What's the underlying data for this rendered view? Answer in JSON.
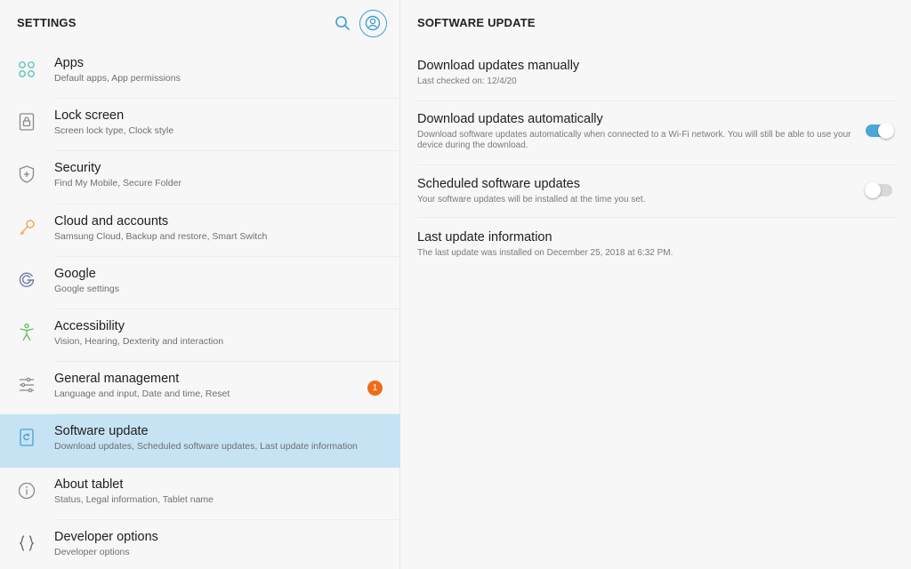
{
  "left": {
    "title": "SETTINGS",
    "menu": [
      {
        "title": "Apps",
        "subtitle": "Default apps, App permissions",
        "icon": "apps-icon"
      },
      {
        "title": "Lock screen",
        "subtitle": "Screen lock type, Clock style",
        "icon": "lock-icon"
      },
      {
        "title": "Security",
        "subtitle": "Find My Mobile, Secure Folder",
        "icon": "shield-icon"
      },
      {
        "title": "Cloud and accounts",
        "subtitle": "Samsung Cloud, Backup and restore, Smart Switch",
        "icon": "key-icon"
      },
      {
        "title": "Google",
        "subtitle": "Google settings",
        "icon": "google-icon"
      },
      {
        "title": "Accessibility",
        "subtitle": "Vision, Hearing, Dexterity and interaction",
        "icon": "accessibility-icon"
      },
      {
        "title": "General management",
        "subtitle": "Language and input, Date and time, Reset",
        "icon": "sliders-icon",
        "badge": "1"
      },
      {
        "title": "Software update",
        "subtitle": "Download updates, Scheduled software updates, Last update information",
        "icon": "software-update-icon",
        "selected": true
      },
      {
        "title": "About tablet",
        "subtitle": "Status, Legal information, Tablet name",
        "icon": "info-icon"
      },
      {
        "title": "Developer options",
        "subtitle": "Developer options",
        "icon": "braces-icon"
      }
    ]
  },
  "right": {
    "title": "SOFTWARE UPDATE",
    "items": [
      {
        "title": "Download updates manually",
        "subtitle": "Last checked on: 12/4/20"
      },
      {
        "title": "Download updates automatically",
        "subtitle": "Download software updates automatically when connected to a Wi-Fi network. You will still be able to use your device during the download.",
        "toggle": true
      },
      {
        "title": "Scheduled software updates",
        "subtitle": "Your software updates will be installed at the time you set.",
        "toggle": false
      },
      {
        "title": "Last update information",
        "subtitle": "The last update was installed on December 25, 2018 at 6:32 PM."
      }
    ]
  },
  "colors": {
    "accent": "#4aa8d8",
    "selected_bg": "#c6e3f3",
    "badge": "#ee6c16"
  }
}
